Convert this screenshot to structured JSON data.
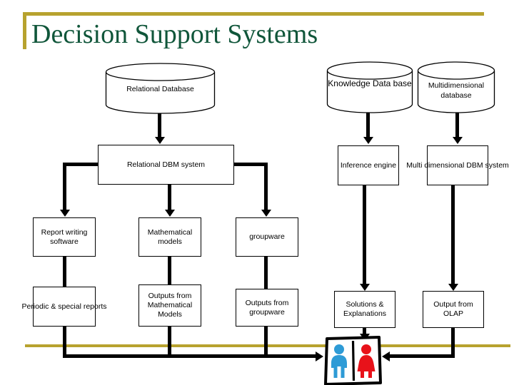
{
  "slide": {
    "title": "Decision Support Systems",
    "accent_color": "#B7A22E",
    "title_color": "#10563A",
    "background": "#ffffff"
  },
  "diagram": {
    "type": "flowchart",
    "stroke_color": "#000000",
    "fill_color": "#ffffff",
    "databases": [
      {
        "id": "relational-database",
        "label": "Relational Database",
        "shape": "cylinder"
      },
      {
        "id": "knowledge-database",
        "label": "Knowledge Data base",
        "shape": "cylinder"
      },
      {
        "id": "multidimensional-database",
        "label": "Multidimensional database",
        "shape": "cylinder"
      }
    ],
    "systems": [
      {
        "id": "relational-dbm-system",
        "label": "Relational DBM system",
        "shape": "rectangle"
      },
      {
        "id": "inference-engine",
        "label": "Inference engine",
        "shape": "rectangle"
      },
      {
        "id": "multi-dimensional-dbm-system",
        "label": "Multi dimensional DBM system",
        "shape": "rectangle"
      }
    ],
    "tools": [
      {
        "id": "report-writing-software",
        "label": "Report writing software",
        "shape": "rectangle"
      },
      {
        "id": "mathematical-models",
        "label": "Mathematical models",
        "shape": "rectangle"
      },
      {
        "id": "groupware",
        "label": "groupware",
        "shape": "rectangle"
      }
    ],
    "outputs": [
      {
        "id": "periodic-special-reports",
        "label": "Periodic & special reports",
        "shape": "rectangle"
      },
      {
        "id": "outputs-from-mathematical-models",
        "label": "Outputs from Mathematical Models",
        "shape": "rectangle"
      },
      {
        "id": "outputs-from-groupware",
        "label": "Outputs from groupware",
        "shape": "rectangle"
      },
      {
        "id": "solutions-explanations",
        "label": "Solutions & Explanations",
        "shape": "rectangle"
      },
      {
        "id": "output-from-olap",
        "label": "Output from OLAP",
        "shape": "rectangle"
      }
    ],
    "users_icon": {
      "id": "users-icon",
      "male_color": "#2E9BD6",
      "female_color": "#E8121A",
      "frame_color": "#000000"
    }
  }
}
